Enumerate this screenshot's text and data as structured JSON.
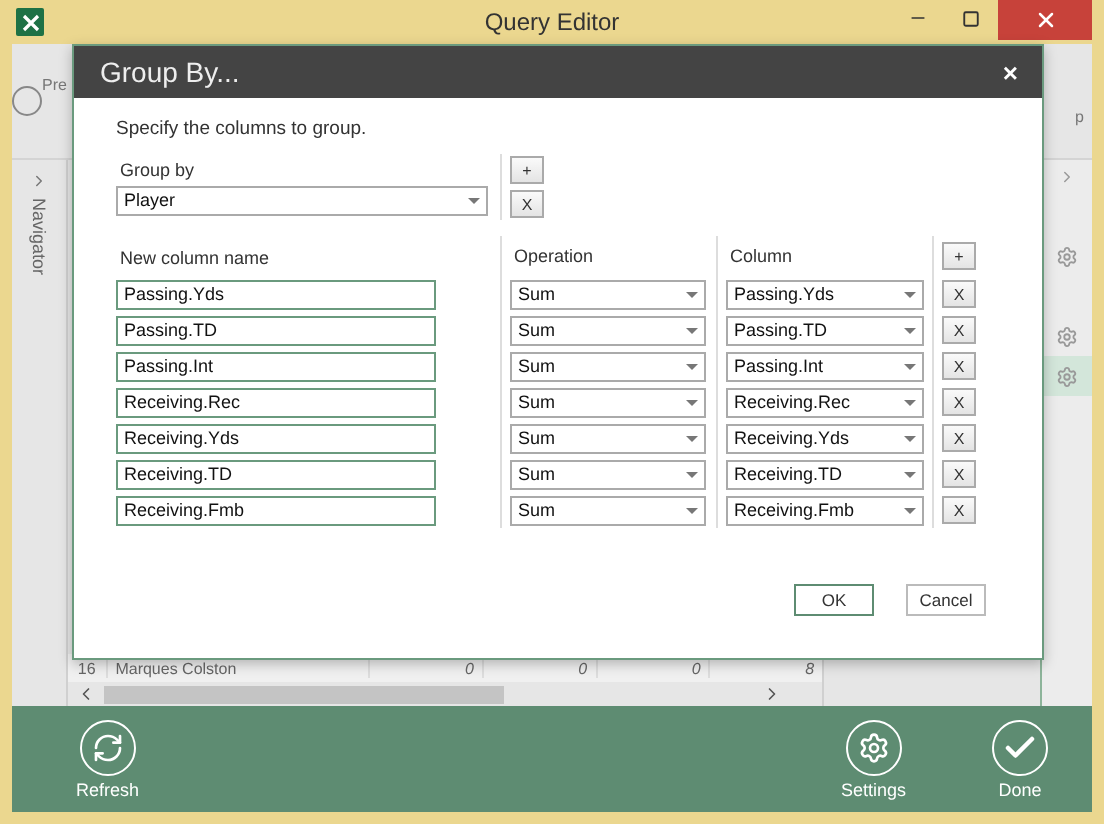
{
  "window": {
    "title": "Query Editor"
  },
  "ribbon": {
    "left_label": "Pre",
    "right_label": "p"
  },
  "navigator": {
    "label": "Navigator"
  },
  "preview_row": {
    "index": "16",
    "cells": [
      "Marques Colston",
      "0",
      "0",
      "0",
      "8"
    ]
  },
  "query_steps": [
    {
      "selected": false
    },
    {
      "selected": false
    },
    {
      "selected": true
    }
  ],
  "footer": {
    "buttons": [
      {
        "kind": "refresh",
        "label": "Refresh"
      },
      {
        "kind": "settings",
        "label": "Settings"
      },
      {
        "kind": "done",
        "label": "Done"
      }
    ]
  },
  "dialog": {
    "title": "Group By...",
    "close": "×",
    "instruction": "Specify the columns to group.",
    "group_by": {
      "label": "Group by",
      "value": "Player",
      "add": "+",
      "remove": "X"
    },
    "columns_header": {
      "name": "New column name",
      "operation": "Operation",
      "column": "Column",
      "add": "+"
    },
    "aggregations": [
      {
        "name": "Passing.Yds",
        "operation": "Sum",
        "column": "Passing.Yds",
        "remove": "X"
      },
      {
        "name": "Passing.TD",
        "operation": "Sum",
        "column": "Passing.TD",
        "remove": "X"
      },
      {
        "name": "Passing.Int",
        "operation": "Sum",
        "column": "Passing.Int",
        "remove": "X"
      },
      {
        "name": "Receiving.Rec",
        "operation": "Sum",
        "column": "Receiving.Rec",
        "remove": "X"
      },
      {
        "name": "Receiving.Yds",
        "operation": "Sum",
        "column": "Receiving.Yds",
        "remove": "X"
      },
      {
        "name": "Receiving.TD",
        "operation": "Sum",
        "column": "Receiving.TD",
        "remove": "X"
      },
      {
        "name": "Receiving.Fmb",
        "operation": "Sum",
        "column": "Receiving.Fmb",
        "remove": "X"
      }
    ],
    "buttons": {
      "ok": "OK",
      "cancel": "Cancel"
    }
  }
}
